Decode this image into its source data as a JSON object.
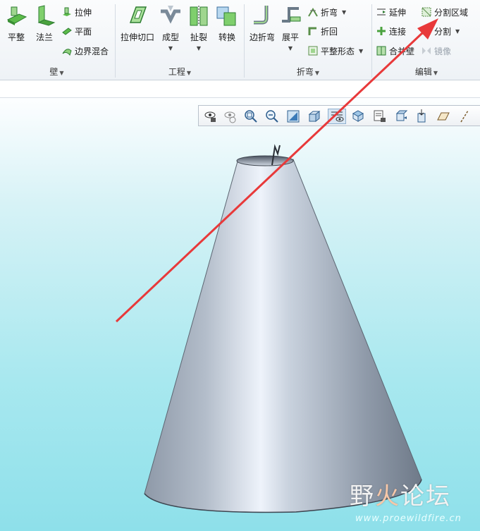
{
  "ribbon": {
    "wall_group": {
      "label": "壁",
      "buttons": {
        "flat": "平整",
        "flange": "法兰"
      },
      "small": {
        "extrude": "拉伸",
        "planar": "平面",
        "boundary_blend": "边界混合"
      }
    },
    "engineering_group": {
      "label": "工程",
      "buttons": {
        "extrude_cut": "拉伸切口",
        "form": "成型",
        "rip": "扯裂",
        "convert": "转换"
      }
    },
    "bend_group": {
      "label": "折弯",
      "buttons": {
        "edge_bend": "边折弯",
        "unbend": "展平"
      },
      "small": {
        "bend": "折弯",
        "bend_back": "折回",
        "flat_state": "平整形态"
      }
    },
    "edit_group": {
      "label": "编辑",
      "small": {
        "extend": "延伸",
        "split_area": "分割区域",
        "join": "连接",
        "split": "分割",
        "merge": "合并壁",
        "mirror": "镜像"
      }
    }
  },
  "view_toolbar": {
    "icons": [
      "saved-views-icon",
      "reorient-icon",
      "zoom-in-icon",
      "zoom-out-icon",
      "refit-icon",
      "display-style-icon",
      "view-manager-icon",
      "perspective-icon",
      "layers-icon",
      "spin-center-icon",
      "annotation-display-icon",
      "point-display-icon",
      "plane-display-icon",
      "axis-display-icon"
    ]
  },
  "watermark": {
    "text_cn_1": "野",
    "text_cn_fire": "火",
    "text_cn_2": "论坛",
    "url": "www.proewildfire.cn"
  },
  "colors": {
    "arrow": "#e8393a",
    "viewport_top": "#fdfeff",
    "viewport_bottom": "#8ee0ea",
    "cone": "#a9b3c0"
  }
}
